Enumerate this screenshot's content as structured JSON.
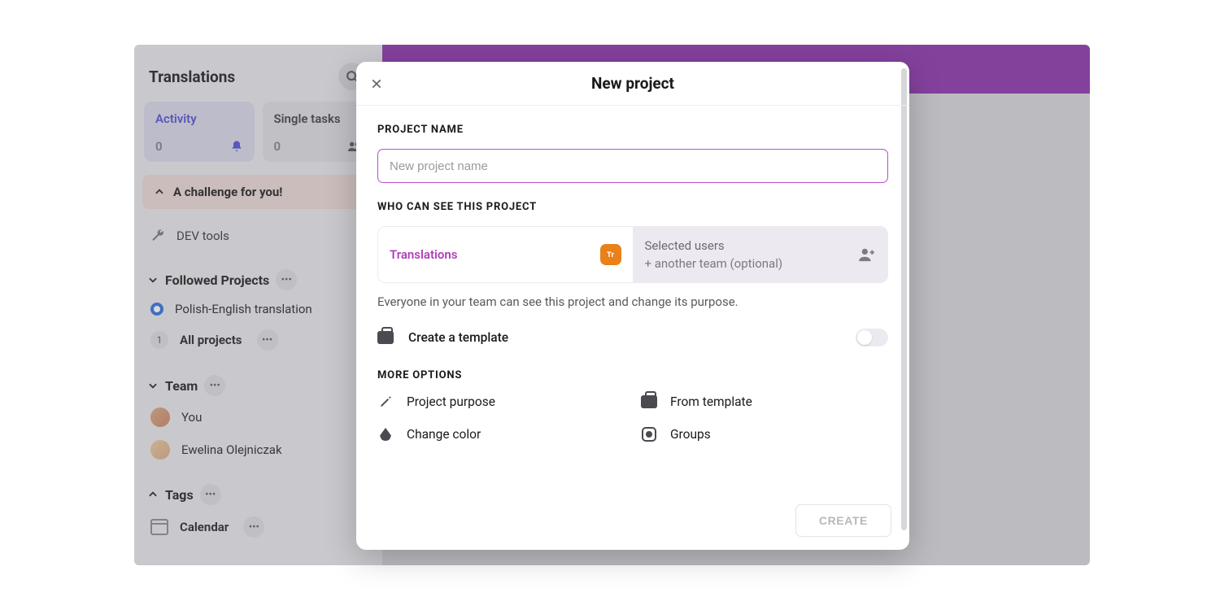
{
  "sidebar": {
    "title": "Translations",
    "tabs": {
      "activity": {
        "label": "Activity",
        "count": "0"
      },
      "single": {
        "label": "Single tasks",
        "count": "0"
      }
    },
    "challenge": "A challenge for you!",
    "dev_tools": "DEV tools",
    "sections": {
      "followed": {
        "title": "Followed Projects",
        "project": "Polish-English translation",
        "all_count": "1",
        "all_label": "All projects"
      },
      "team": {
        "title": "Team",
        "you": "You",
        "member": "Ewelina Olejniczak"
      },
      "tags": {
        "title": "Tags"
      },
      "calendar": "Calendar"
    }
  },
  "modal": {
    "title": "New project",
    "project_name_label": "PROJECT NAME",
    "name_placeholder": "New project name",
    "visibility_label": "WHO CAN SEE THIS PROJECT",
    "vis_left": "Translations",
    "team_chip": "Tr",
    "vis_right_top": "Selected users",
    "vis_right_bottom": "+ another team (optional)",
    "vis_help": "Everyone in your team can see this project and change its purpose.",
    "template_label": "Create a template",
    "more_label": "MORE OPTIONS",
    "options": {
      "purpose": "Project purpose",
      "from_template": "From template",
      "color": "Change color",
      "groups": "Groups"
    },
    "create": "CREATE"
  }
}
